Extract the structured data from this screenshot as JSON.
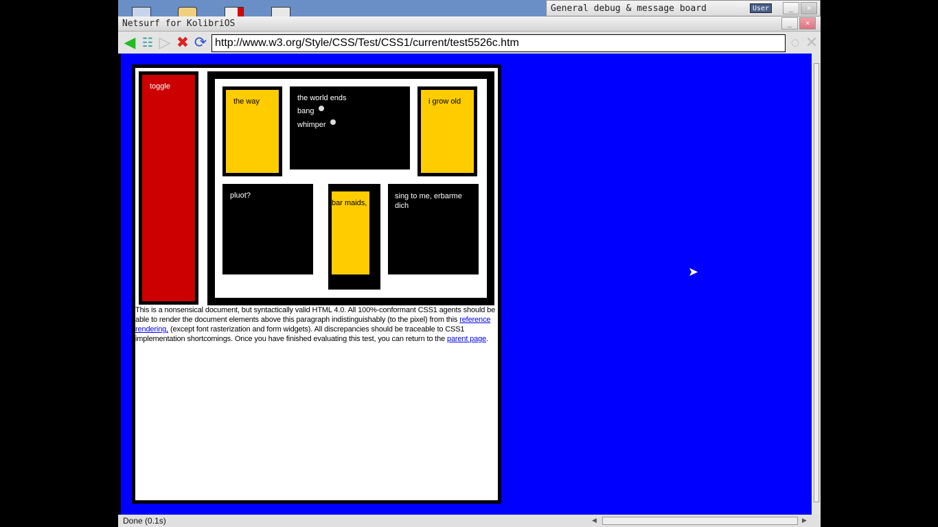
{
  "desktop": {
    "taskbar_icons": [
      "floppy-icon",
      "folder-icon",
      "book-icon",
      "calculator-icon"
    ]
  },
  "debug_board": {
    "title": "General debug & message board",
    "user_label": "User",
    "minimize": "_",
    "close": "×"
  },
  "browser": {
    "title": "Netsurf for KolibriOS",
    "minimize": "_",
    "close": "×",
    "url": "http://www.w3.org/Style/CSS/Test/CSS1/current/test5526c.htm",
    "status": "Done (0.1s)"
  },
  "page": {
    "toggle": "toggle",
    "the_way": "the way",
    "world_ends": "the world ends",
    "bang": "bang",
    "whimper": "whimper",
    "grow_old": "i grow old",
    "pluot": "pluot?",
    "bar_maids": "bar maids,",
    "sing": "sing to me, erbarme dich",
    "para_1": "This is a nonsensical document, but syntactically valid HTML 4.0. All 100%-conformant CSS1 agents should be able to render the document elements above this paragraph indistinguishably (to the pixel) from this ",
    "link_reference": "reference rendering,",
    "para_2": " (except font rasterization and form widgets). All discrepancies should be traceable to CSS1 implementation shortcomings. Once you have finished evaluating this test, you can return to the ",
    "link_parent": "parent page",
    "para_3": "."
  },
  "colors": {
    "content_bg": "#0000ff",
    "yellow": "#ffcc00",
    "red": "#cc0000"
  }
}
